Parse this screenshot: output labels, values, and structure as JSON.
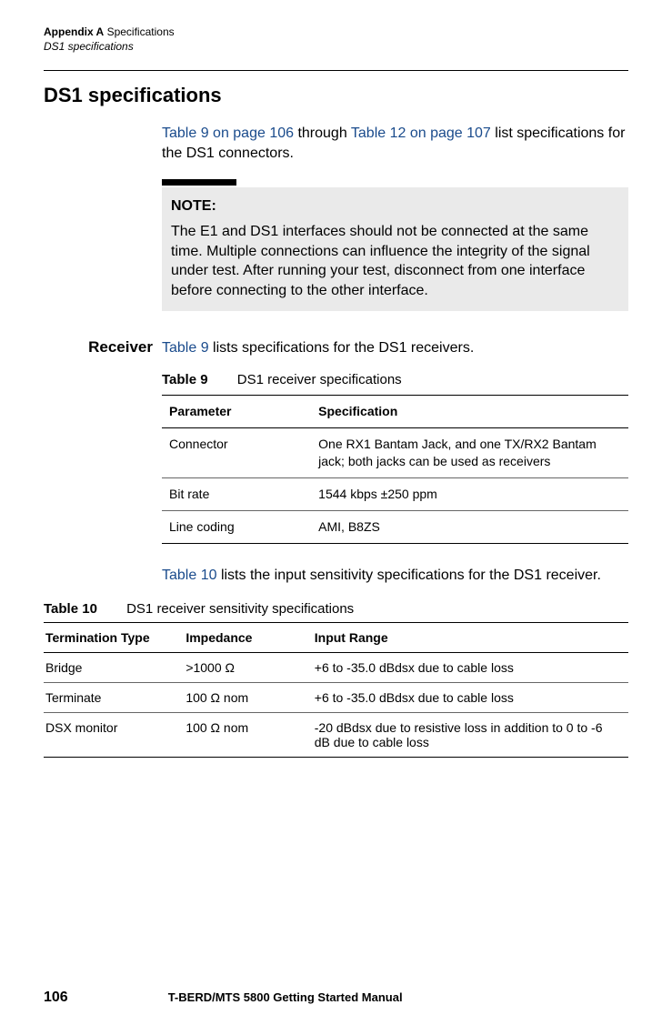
{
  "header": {
    "appendix": "Appendix A",
    "appendixTitle": "Specifications",
    "subtitle": "DS1 specifications"
  },
  "h1": "DS1 specifications",
  "intro": {
    "link1": "Table 9 on page 106",
    "mid1": " through ",
    "link2": "Table 12 on page 107",
    "rest": " list specifications for the DS1 connectors."
  },
  "note": {
    "label": "NOTE:",
    "text": "The E1 and DS1 interfaces should not be connected at the same time. Multiple connections can influence the integrity of the signal under test. After running your test, disconnect from one interface before connecting to the other interface."
  },
  "receiver": {
    "label": "Receiver",
    "intro_link": "Table 9",
    "intro_rest": " lists specifications for the DS1 receivers."
  },
  "table9": {
    "captionLabel": "Table 9",
    "captionText": "DS1 receiver specifications",
    "headers": {
      "param": "Parameter",
      "spec": "Specification"
    },
    "rows": [
      {
        "param": "Connector",
        "spec": "One RX1 Bantam Jack, and one TX/RX2 Bantam jack; both jacks can be used as receivers"
      },
      {
        "param": "Bit rate",
        "spec": "1544 kbps ±250 ppm"
      },
      {
        "param": "Line coding",
        "spec": "AMI, B8ZS"
      }
    ]
  },
  "afterTable9": {
    "link": "Table 10",
    "rest": " lists the input sensitivity specifications for the DS1 receiver."
  },
  "table10": {
    "captionLabel": "Table 10",
    "captionText": "DS1 receiver sensitivity specifications",
    "headers": {
      "term": "Termination Type",
      "imp": "Impedance",
      "range": "Input Range"
    },
    "rows": [
      {
        "term": "Bridge",
        "imp": ">1000 Ω",
        "range": "+6 to -35.0 dBdsx due to cable loss"
      },
      {
        "term": "Terminate",
        "imp": "100 Ω nom",
        "range": "+6 to -35.0 dBdsx due to cable loss"
      },
      {
        "term": "DSX monitor",
        "imp": "100 Ω nom",
        "range": "-20 dBdsx due to resistive loss in addition to 0 to -6 dB due to cable loss"
      }
    ]
  },
  "footer": {
    "page": "106",
    "title": "T-BERD/MTS 5800 Getting Started Manual"
  }
}
